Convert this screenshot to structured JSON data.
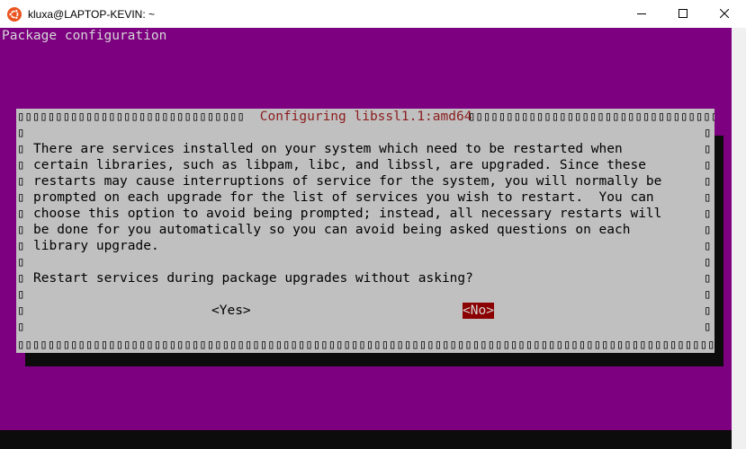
{
  "window": {
    "title": "kluxa@LAPTOP-KEVIN: ~",
    "app_icon": "ubuntu-icon",
    "controls": [
      "minimize-icon",
      "maximize-icon",
      "close-icon"
    ]
  },
  "terminal": {
    "background": "#7d0080",
    "header": "Package configuration",
    "dialog": {
      "title": " Configuring libssl1.1:amd64 ",
      "frame_top_left": "▯▯▯▯▯▯▯▯▯▯▯▯▯▯▯▯▯▯▯▯▯▯▯▯▯▯▯▯▯▯▯▯▯▯▯▯▯▯▯▯▯▯▯▯▯",
      "frame_top_right": "▯▯▯▯▯▯▯▯▯▯▯▯▯▯▯▯▯▯▯▯▯▯▯▯▯▯▯▯▯▯▯▯▯▯▯▯▯▯▯▯▯▯▯▯▯▯▯▯",
      "frame_bottom": "▯▯▯▯▯▯▯▯▯▯▯▯▯▯▯▯▯▯▯▯▯▯▯▯▯▯▯▯▯▯▯▯▯▯▯▯▯▯▯▯▯▯▯▯▯▯▯▯▯▯▯▯▯▯▯▯▯▯▯▯▯▯▯▯▯▯▯▯▯▯▯▯▯▯▯▯▯▯▯▯▯▯▯▯▯▯▯▯▯▯▯▯▯▯▯▯▯▯▯▯▯▯▯▯▯▯▯▯▯▯▯▯▯▯▯▯▯▯▯▯▯▯▯▯▯▯▯▯▯▯▯▯▯▯▯▯▯▯▯▯▯▯▯▯▯▯▯",
      "frame_sides": "▯\n▯\n▯\n▯\n▯\n▯\n▯\n▯\n▯\n▯\n▯\n▯\n▯",
      "body_lines": [
        "There are services installed on your system which need to be restarted when",
        "certain libraries, such as libpam, libc, and libssl, are upgraded. Since these",
        "restarts may cause interruptions of service for the system, you will normally be",
        "prompted on each upgrade for the list of services you wish to restart.  You can",
        "choose this option to avoid being prompted; instead, all necessary restarts will",
        "be done for you automatically so you can avoid being asked questions on each",
        "library upgrade."
      ],
      "question": "Restart services during package upgrades without asking?",
      "buttons": {
        "yes": "<Yes>",
        "no": "<No>",
        "selected": "no"
      }
    }
  }
}
